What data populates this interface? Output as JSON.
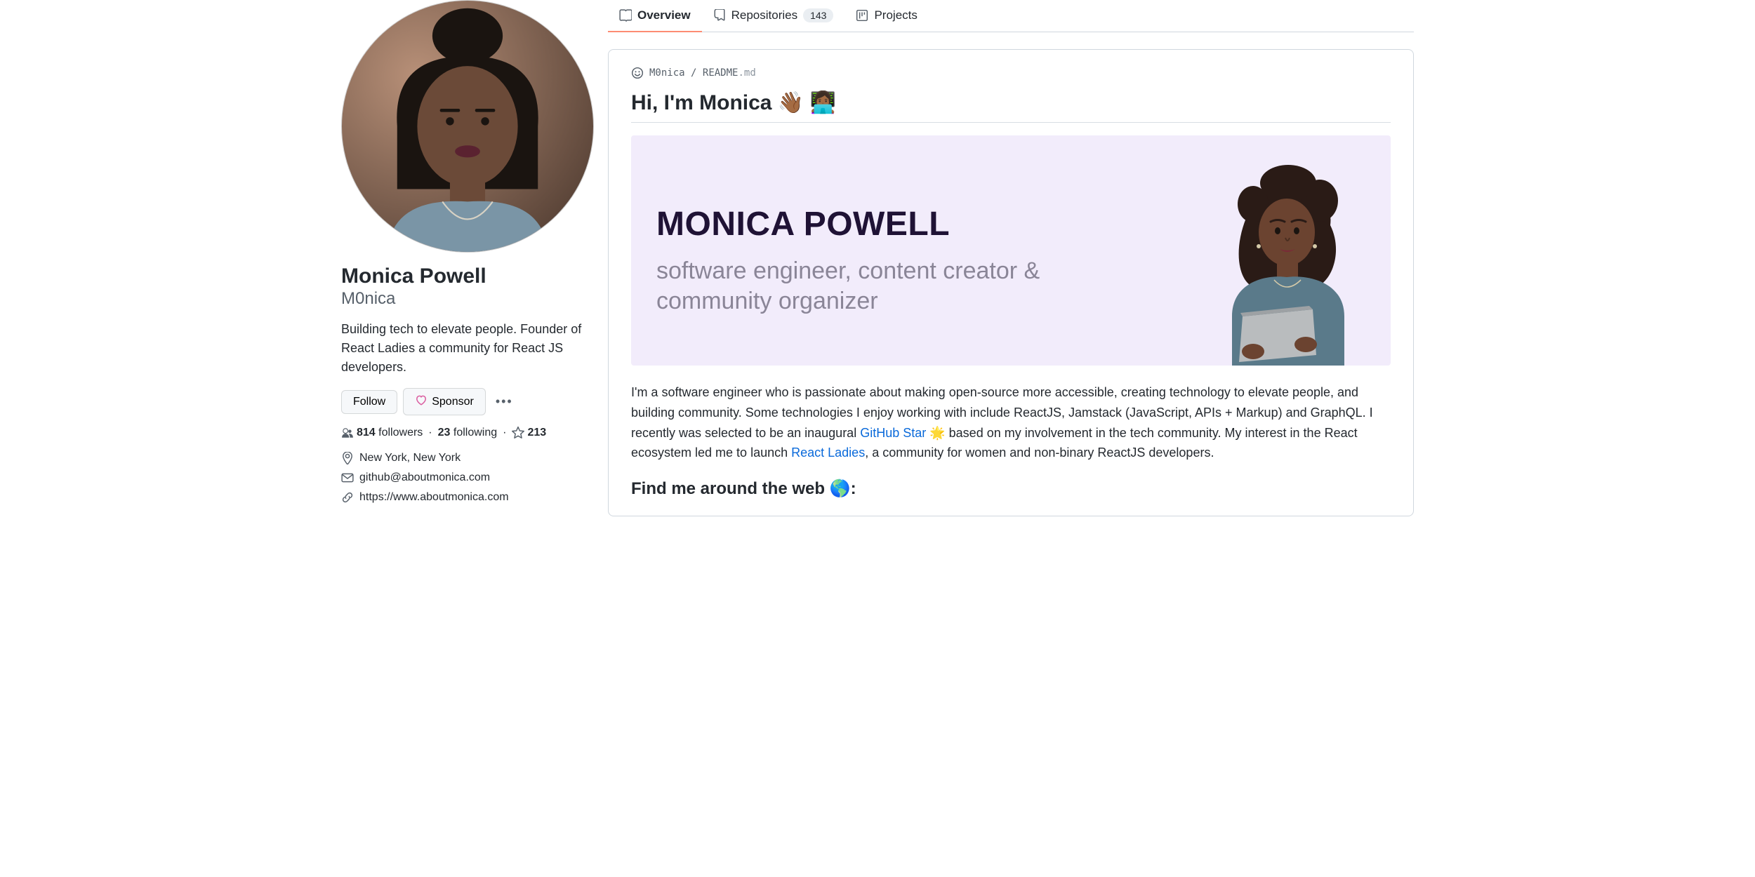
{
  "tabs": {
    "overview": "Overview",
    "repositories": "Repositories",
    "repo_count": "143",
    "projects": "Projects"
  },
  "profile": {
    "name": "Monica Powell",
    "username": "M0nica",
    "bio": "Building tech to elevate people. Founder of React Ladies a community for React JS developers.",
    "follow_btn": "Follow",
    "sponsor_btn": "Sponsor",
    "followers_count": "814",
    "followers_label": "followers",
    "following_count": "23",
    "following_label": "following",
    "stars_count": "213",
    "location": "New York, New York",
    "email": "github@aboutmonica.com",
    "website": "https://www.aboutmonica.com"
  },
  "readme": {
    "path_user": "M0nica",
    "path_slash": "/",
    "path_file": "README",
    "path_ext": ".md",
    "heading": "Hi, I'm Monica 👋🏾 👩🏾‍💻",
    "banner_name": "MONICA POWELL",
    "banner_tag": "software engineer, content creator & community organizer",
    "p1a": "I'm a software engineer who is passionate about making open-source more accessible, creating technology to elevate people, and building community. Some technologies I enjoy working with include ReactJS, Jamstack (JavaScript, APIs + Markup) and GraphQL. I recently was selected to be an inaugural ",
    "link1": "GitHub Star",
    "p1b": " 🌟  based on my involvement in the tech community. My interest in the React ecosystem led me to launch ",
    "link2": "React Ladies",
    "p1c": ", a community for women and non-binary ReactJS developers.",
    "h2": "Find me around the web 🌎:"
  }
}
